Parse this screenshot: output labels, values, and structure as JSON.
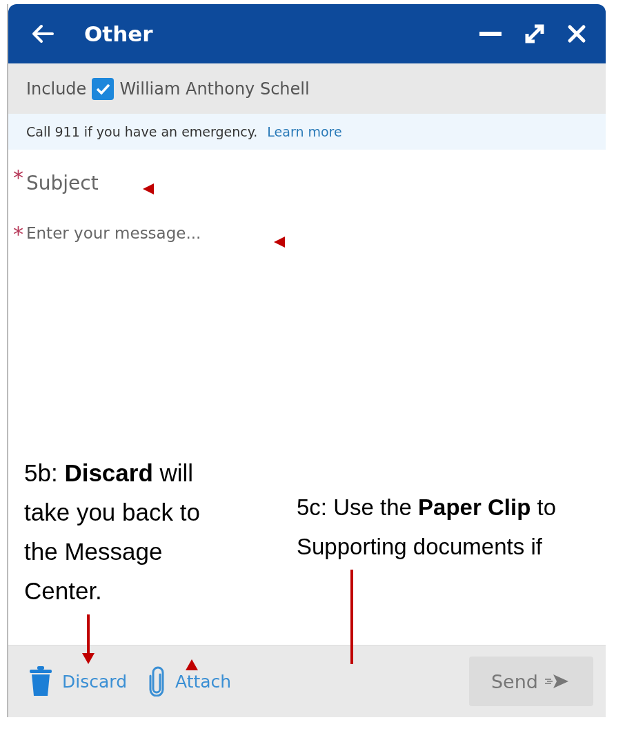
{
  "window": {
    "title": "Other",
    "controls": [
      {
        "kind": "minimize"
      },
      {
        "kind": "maximize"
      },
      {
        "kind": "close"
      }
    ]
  },
  "include": {
    "label": "Include",
    "recipient": "William Anthony Schell",
    "checked": true
  },
  "notice": {
    "text": "Call 911 if you have an emergency.",
    "link": "Learn more"
  },
  "form": {
    "subject": {
      "placeholder": "Subject",
      "required_mark": "*"
    },
    "message": {
      "placeholder": "Enter your message...",
      "required_mark": "*"
    }
  },
  "footer": {
    "actions": [
      {
        "kind": "discard",
        "label": "Discard"
      },
      {
        "kind": "attach",
        "label": "Attach"
      }
    ],
    "send": {
      "label": "Send",
      "disabled": true
    }
  },
  "annotations": [
    {
      "lines": [
        "5b: **Discard** will",
        "take you back to",
        "the Message",
        "Center."
      ]
    },
    {
      "lines": [
        "5c: Use the **Paper Clip** to",
        "Supporting documents if"
      ]
    }
  ],
  "markers": [
    {
      "kind": "pointer"
    },
    {
      "kind": "pointer"
    },
    {
      "kind": "arrow"
    },
    {
      "kind": "pointer"
    },
    {
      "kind": "line"
    }
  ]
}
